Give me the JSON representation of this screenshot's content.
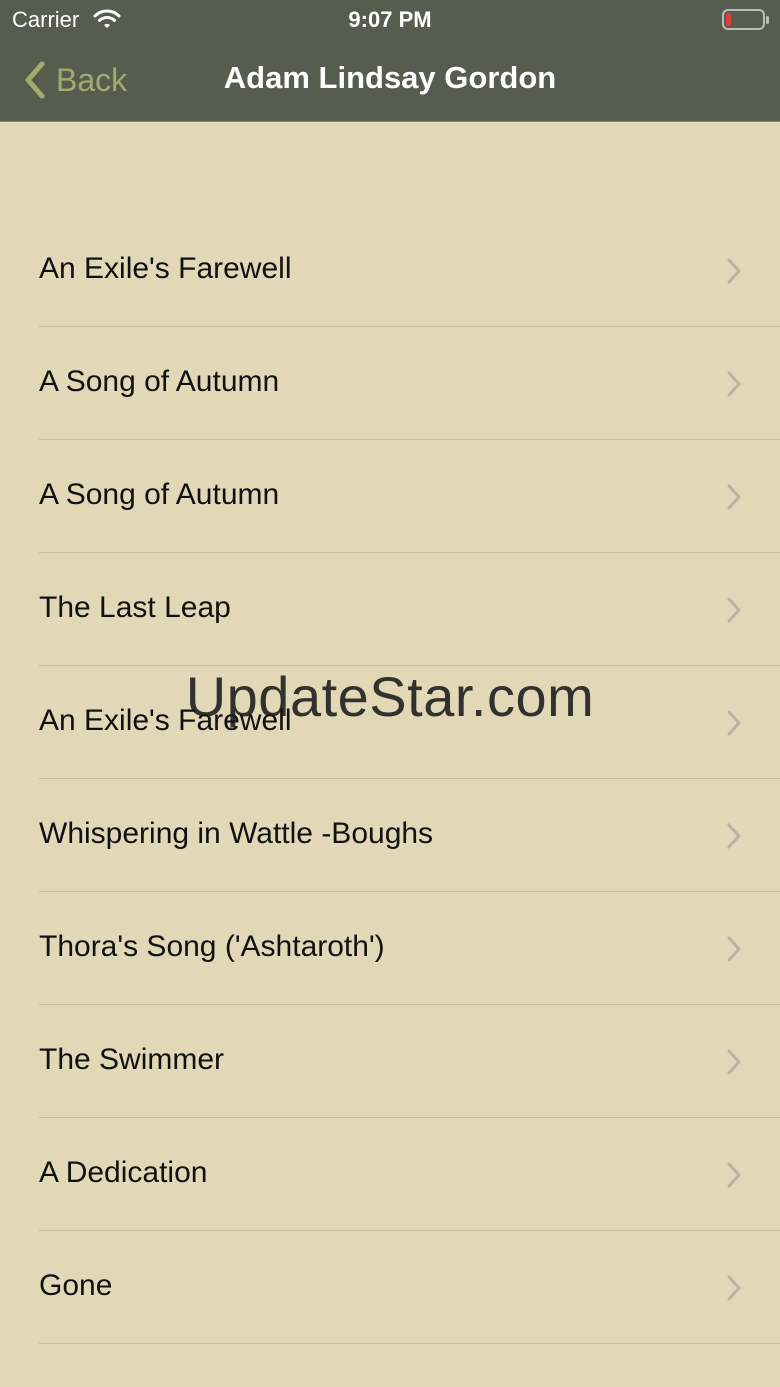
{
  "status_bar": {
    "carrier": "Carrier",
    "time": "9:07 PM"
  },
  "nav": {
    "back_label": "Back",
    "title": "Adam Lindsay Gordon"
  },
  "poems": [
    "An Exile's Farewell",
    "A Song of Autumn",
    "A Song of Autumn",
    "The Last Leap",
    "An Exile's Farewell",
    "Whispering in Wattle -Boughs",
    "Thora's Song ('Ashtaroth')",
    "The Swimmer",
    "A Dedication",
    "Gone"
  ],
  "watermark": "UpdateStar.com",
  "colors": {
    "nav_background": "#555d4e",
    "page_background": "#e2d8b8",
    "accent": "#a3aa6f",
    "battery_low": "#e0393e"
  },
  "icons": {
    "back": "chevron-left-icon",
    "row": "chevron-right-icon",
    "wifi": "wifi-icon",
    "battery": "battery-icon"
  }
}
